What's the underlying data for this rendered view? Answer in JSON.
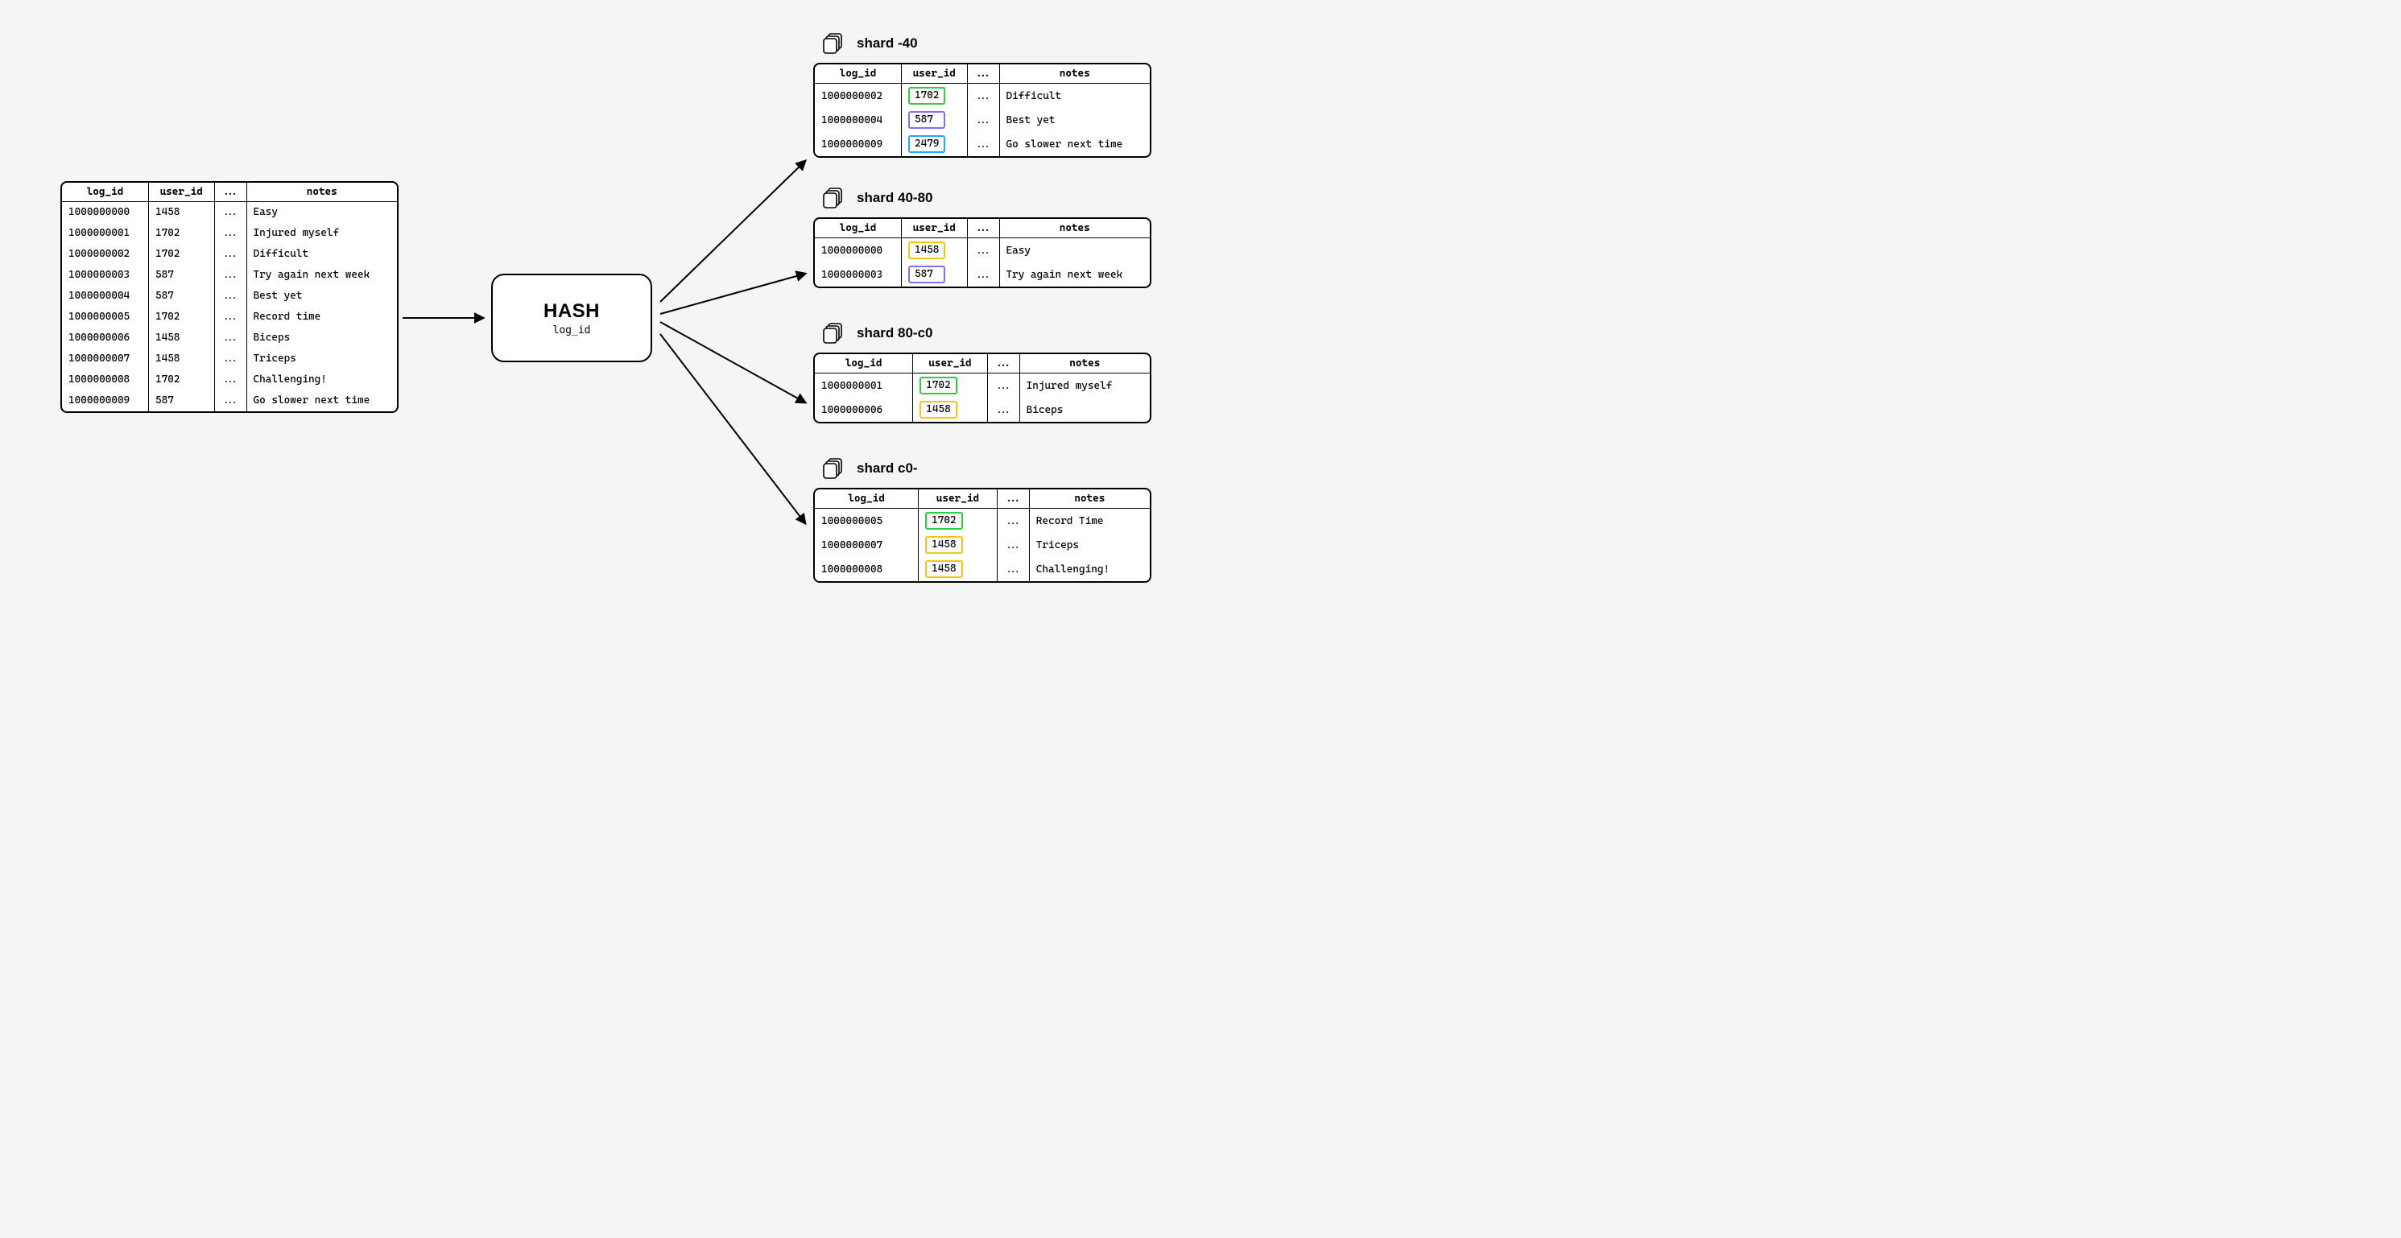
{
  "columns": {
    "log_id": "log_id",
    "user_id": "user_id",
    "dots": "...",
    "notes": "notes"
  },
  "hash": {
    "title": "HASH",
    "key": "log_id"
  },
  "colors": {
    "green": "#2ecc40",
    "purple": "#8b6ef0",
    "blue": "#1fa8ff",
    "yellow": "#f5c518"
  },
  "source_table": [
    {
      "log_id": "1000000000",
      "user_id": "1458",
      "notes": "Easy"
    },
    {
      "log_id": "1000000001",
      "user_id": "1702",
      "notes": "Injured myself"
    },
    {
      "log_id": "1000000002",
      "user_id": "1702",
      "notes": "Difficult"
    },
    {
      "log_id": "1000000003",
      "user_id": "587",
      "notes": "Try again next week"
    },
    {
      "log_id": "1000000004",
      "user_id": "587",
      "notes": "Best yet"
    },
    {
      "log_id": "1000000005",
      "user_id": "1702",
      "notes": "Record time"
    },
    {
      "log_id": "1000000006",
      "user_id": "1458",
      "notes": "Biceps"
    },
    {
      "log_id": "1000000007",
      "user_id": "1458",
      "notes": "Triceps"
    },
    {
      "log_id": "1000000008",
      "user_id": "1702",
      "notes": "Challenging!"
    },
    {
      "log_id": "1000000009",
      "user_id": "587",
      "notes": "Go slower next time"
    }
  ],
  "shards": [
    {
      "label": "shard -40",
      "rows": [
        {
          "log_id": "1000000002",
          "user_id": "1702",
          "notes": "Difficult",
          "hl": "green"
        },
        {
          "log_id": "1000000004",
          "user_id": "587",
          "notes": "Best yet",
          "hl": "purple"
        },
        {
          "log_id": "1000000009",
          "user_id": "2479",
          "notes": "Go slower next time",
          "hl": "blue"
        }
      ]
    },
    {
      "label": "shard 40-80",
      "rows": [
        {
          "log_id": "1000000000",
          "user_id": "1458",
          "notes": "Easy",
          "hl": "yellow"
        },
        {
          "log_id": "1000000003",
          "user_id": "587",
          "notes": "Try again next week",
          "hl": "purple"
        }
      ]
    },
    {
      "label": "shard 80-c0",
      "rows": [
        {
          "log_id": "1000000001",
          "user_id": "1702",
          "notes": "Injured myself",
          "hl": "green"
        },
        {
          "log_id": "1000000006",
          "user_id": "1458",
          "notes": "Biceps",
          "hl": "yellow"
        }
      ]
    },
    {
      "label": "shard c0-",
      "rows": [
        {
          "log_id": "1000000005",
          "user_id": "1702",
          "notes": "Record Time",
          "hl": "green"
        },
        {
          "log_id": "1000000007",
          "user_id": "1458",
          "notes": "Triceps",
          "hl": "yellow"
        },
        {
          "log_id": "1000000008",
          "user_id": "1458",
          "notes": "Challenging!",
          "hl": "yellow"
        }
      ]
    }
  ]
}
